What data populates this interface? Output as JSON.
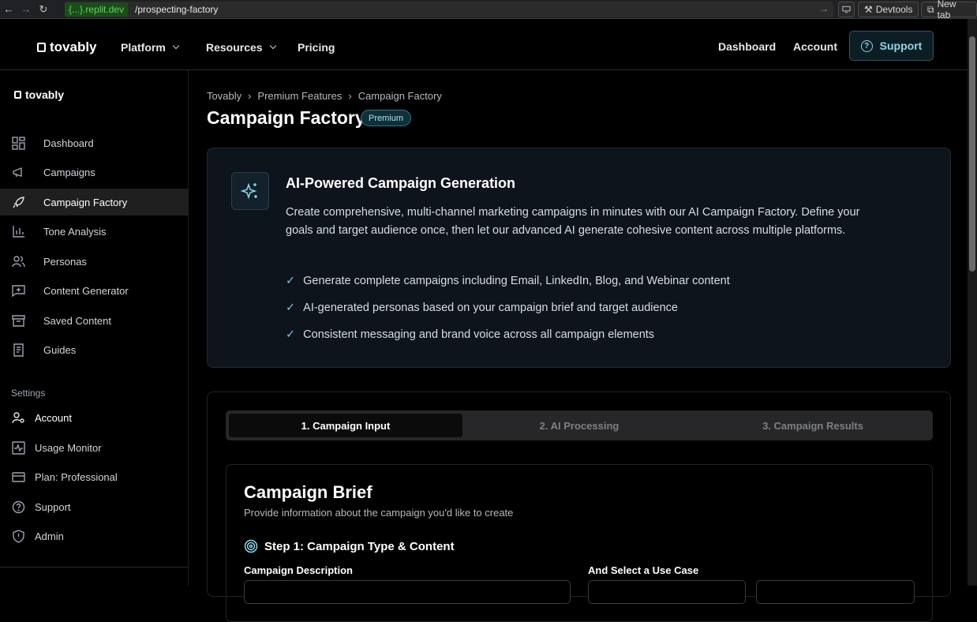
{
  "browser": {
    "url_host": "{...}.replit.dev",
    "url_path": "/prospecting-factory",
    "devtools_label": "Devtools",
    "newtab_label": "New tab"
  },
  "topnav": {
    "logo": "tovably",
    "links": [
      "Platform",
      "Resources",
      "Pricing"
    ],
    "right_links": [
      "Dashboard",
      "Account"
    ],
    "support_label": "Support"
  },
  "sidebar": {
    "logo": "tovably",
    "items": [
      {
        "label": "Dashboard",
        "icon": "grid-icon"
      },
      {
        "label": "Campaigns",
        "icon": "megaphone-icon"
      },
      {
        "label": "Campaign Factory",
        "icon": "rocket-icon",
        "active": true
      },
      {
        "label": "Tone Analysis",
        "icon": "bar-chart-icon"
      },
      {
        "label": "Personas",
        "icon": "users-icon"
      },
      {
        "label": "Content Generator",
        "icon": "message-plus-icon"
      },
      {
        "label": "Saved Content",
        "icon": "archive-icon"
      },
      {
        "label": "Guides",
        "icon": "book-icon"
      }
    ],
    "settings_header": "Settings",
    "settings_items": [
      {
        "label": "Account",
        "icon": "user-cog-icon"
      },
      {
        "label": "Usage Monitor",
        "icon": "activity-icon"
      },
      {
        "label": "Plan: Professional",
        "icon": "credit-card-icon"
      },
      {
        "label": "Support",
        "icon": "help-circle-icon"
      },
      {
        "label": "Admin",
        "icon": "shield-icon"
      }
    ]
  },
  "main": {
    "breadcrumb": [
      "Tovably",
      "Premium Features",
      "Campaign Factory"
    ],
    "title": "Campaign Factory",
    "badge": "Premium",
    "hero": {
      "title": "AI-Powered Campaign Generation",
      "description": "Create comprehensive, multi-channel marketing campaigns in minutes with our AI Campaign Factory. Define your goals and target audience once, then let our advanced AI generate cohesive content across multiple platforms.",
      "bullets": [
        "Generate complete campaigns including Email, LinkedIn, Blog, and Webinar content",
        "AI-generated personas based on your campaign brief and target audience",
        "Consistent messaging and brand voice across all campaign elements"
      ]
    },
    "tabs": [
      "1. Campaign Input",
      "2. AI Processing",
      "3. Campaign Results"
    ],
    "brief": {
      "title": "Campaign Brief",
      "subtitle": "Provide information about the campaign you'd like to create",
      "step_title": "Step 1: Campaign Type & Content",
      "description_label": "Campaign Description",
      "use_case_label": "And Select a Use Case"
    }
  },
  "colors": {
    "accent": "#8fd6ea",
    "background": "#000000",
    "hero_bg": "#0d141c"
  }
}
